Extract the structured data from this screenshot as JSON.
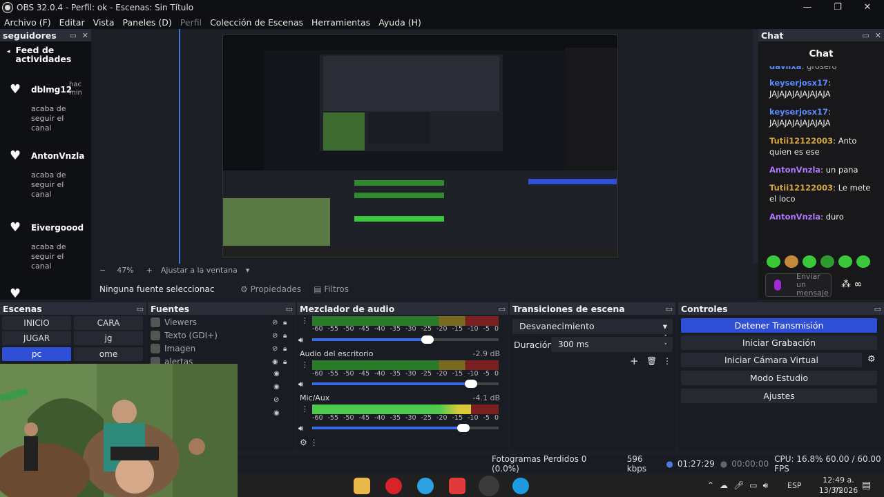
{
  "window": {
    "title": "OBS 32.0.4 - Perfil: ok - Escenas: Sin Título",
    "min": "—",
    "max": "❐",
    "close": "✕"
  },
  "menu": [
    {
      "label": "Archivo (F)",
      "dim": false
    },
    {
      "label": "Editar",
      "dim": false
    },
    {
      "label": "Vista",
      "dim": false
    },
    {
      "label": "Paneles (D)",
      "dim": false
    },
    {
      "label": "Perfil",
      "dim": true
    },
    {
      "label": "Colección de Escenas",
      "dim": false
    },
    {
      "label": "Herramientas",
      "dim": false
    },
    {
      "label": "Ayuda (H)",
      "dim": false
    }
  ],
  "followers": {
    "dock_title": "seguidores",
    "feed_title": "Feed de actividades",
    "items": [
      {
        "name": "dblmg12",
        "time": "hac min",
        "desc": "acaba de seguir el canal"
      },
      {
        "name": "AntonVnzla",
        "time": "",
        "desc": "acaba de seguir el canal"
      },
      {
        "name": "Eivergoood",
        "time": "",
        "desc": "acaba de seguir el canal"
      }
    ]
  },
  "zoom": {
    "minus": "−",
    "value": "47%",
    "plus": "+",
    "fit": "Ajustar a la ventana"
  },
  "source_toolbar": {
    "no_source": "Ninguna fuente seleccionac",
    "properties": "Propiedades",
    "filters": "Filtros"
  },
  "chat": {
    "dock_title": "Chat",
    "title": "Chat",
    "partial_top": "grosero",
    "messages": [
      {
        "user": "keyserjosx17",
        "text": "JAJAJAJAJAJAJAJA",
        "color": "#5b8cff"
      },
      {
        "user": "keyserjosx17",
        "text": "JAJAJAJAJAJAJAJA",
        "color": "#5b8cff"
      },
      {
        "user": "Tutii12122003",
        "text": "Anto quien es ese",
        "color": "#d6a53a"
      },
      {
        "user": "AntonVnzla",
        "text": "un pana",
        "color": "#b278ff"
      },
      {
        "user": "Tutii12122003",
        "text": "Le mete el loco",
        "color": "#d6a53a"
      },
      {
        "user": "AntonVnzla",
        "text": "duro",
        "color": "#b278ff"
      }
    ],
    "send_placeholder": "Enviar un mensaje"
  },
  "scenes": {
    "title": "Escenas",
    "items": [
      {
        "label": "INICIO",
        "selected": false
      },
      {
        "label": "CARA",
        "selected": false
      },
      {
        "label": "JUGAR",
        "selected": false
      },
      {
        "label": "jg",
        "selected": false
      },
      {
        "label": "pc",
        "selected": true
      },
      {
        "label": "ome",
        "selected": false
      }
    ]
  },
  "sources": {
    "title": "Fuentes",
    "items": [
      {
        "label": "Viewers"
      },
      {
        "label": "Texto (GDI+)"
      },
      {
        "label": "Imagen"
      },
      {
        "label": "alertas"
      }
    ]
  },
  "mixer": {
    "title": "Mezclador de audio",
    "ticks": [
      "-60",
      "-55",
      "-50",
      "-45",
      "-40",
      "-35",
      "-30",
      "-25",
      "-20",
      "-15",
      "-10",
      "-5",
      "0"
    ],
    "channels": [
      {
        "name": "",
        "db": "",
        "level": 0.0,
        "volume": 0.62
      },
      {
        "name": "Audio del escritorio",
        "db": "-2.9 dB",
        "level": 0.0,
        "volume": 0.85
      },
      {
        "name": "Mic/Aux",
        "db": "-4.1 dB",
        "level": 0.85,
        "volume": 0.81
      }
    ]
  },
  "transitions": {
    "title": "Transiciones de escena",
    "selected": "Desvanecimiento",
    "duration_label": "Duración",
    "duration_value": "300 ms"
  },
  "controls": {
    "title": "Controles",
    "buttons": [
      {
        "label": "Detener Transmisión",
        "primary": true
      },
      {
        "label": "Iniciar Grabación",
        "primary": false
      },
      {
        "label": "Iniciar Cámara Virtual",
        "primary": false
      },
      {
        "label": "Modo Estudio",
        "primary": false
      },
      {
        "label": "Ajustes",
        "primary": false
      }
    ]
  },
  "status": {
    "dropped": "Fotogramas Perdidos 0 (0.0%)",
    "bitrate": "596 kbps",
    "stream_time": "01:27:29",
    "rec_time": "00:00:00",
    "cpu": "CPU: 16.8% 60.00 / 60.00 FPS"
  },
  "taskbar": {
    "lang": "ESP",
    "time": "12:49 a. m.",
    "date": "13/3/2026"
  }
}
